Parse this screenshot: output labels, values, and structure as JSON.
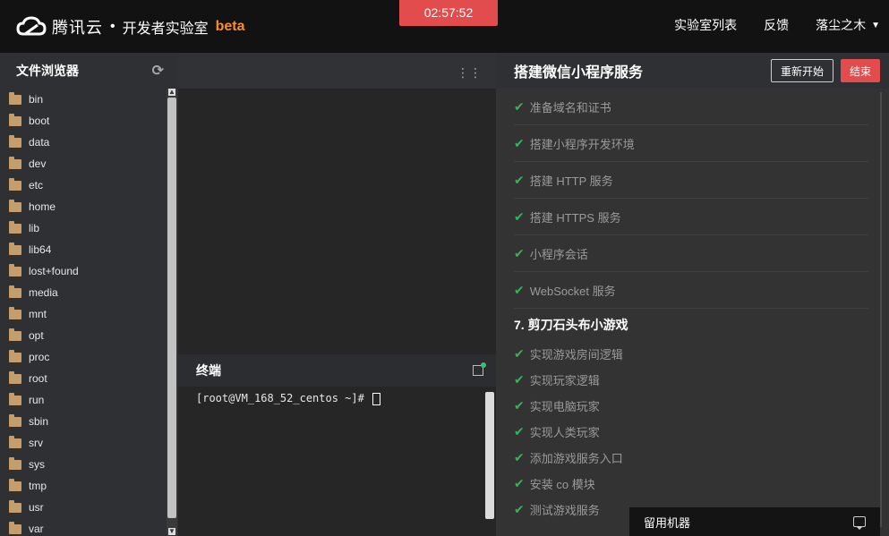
{
  "header": {
    "brand": "腾讯云",
    "separator": "•",
    "lab": "开发者实验室",
    "beta": "beta",
    "timer": "02:57:52",
    "nav": [
      "实验室列表",
      "反馈",
      "落尘之木"
    ]
  },
  "left": {
    "title": "文件浏览器",
    "files": [
      "bin",
      "boot",
      "data",
      "dev",
      "etc",
      "home",
      "lib",
      "lib64",
      "lost+found",
      "media",
      "mnt",
      "opt",
      "proc",
      "root",
      "run",
      "sbin",
      "srv",
      "sys",
      "tmp",
      "usr",
      "var"
    ]
  },
  "terminal": {
    "title": "终端",
    "prompt": "[root@VM_168_52_centos ~]#"
  },
  "right": {
    "title": "搭建微信小程序服务",
    "restart": "重新开始",
    "end": "结束",
    "steps_done": [
      "准备域名和证书",
      "搭建小程序开发环境",
      "搭建 HTTP 服务",
      "搭建 HTTPS 服务",
      "小程序会话",
      "WebSocket 服务"
    ],
    "section": "7. 剪刀石头布小游戏",
    "substeps": [
      "实现游戏房间逻辑",
      "实现玩家逻辑",
      "实现电脑玩家",
      "实现人类玩家",
      "添加游戏服务入口",
      "安装 co 模块",
      "测试游戏服务"
    ]
  },
  "keep_machine": "留用机器",
  "colors": {
    "accent": "#e24c4c",
    "check": "#35b25a",
    "beta": "#ff8a2b"
  }
}
